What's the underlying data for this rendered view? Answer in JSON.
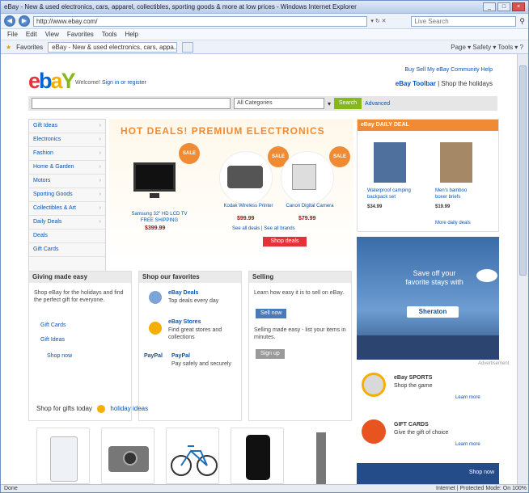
{
  "window": {
    "title": "eBay - New & used electronics, cars, apparel, collectibles, sporting goods & more at low prices - Windows Internet Explorer",
    "buttons": [
      "_",
      "□",
      "×"
    ]
  },
  "address": {
    "url": "http://www.ebay.com/",
    "search_placeholder": "Live Search"
  },
  "menu": [
    "File",
    "Edit",
    "View",
    "Favorites",
    "Tools",
    "Help"
  ],
  "favorites": {
    "label": "Favorites",
    "tab": "eBay - New & used electronics, cars, appa...",
    "right": "Page ▾  Safety ▾  Tools ▾  ?"
  },
  "ebay": {
    "logo": {
      "e": "e",
      "b": "b",
      "a": "a",
      "y": "Y"
    },
    "signin_text": "Welcome! ",
    "signin_link": "Sign in or register",
    "top_links": "Buy   Sell   My eBay   Community   Help",
    "promo_text": "eBay Toolbar",
    "promo_link": "| Shop the holidays",
    "search": {
      "category": "All Categories",
      "button": "Search",
      "advanced": "Advanced"
    },
    "categories": [
      "Gift Ideas",
      "Electronics",
      "Fashion",
      "Home & Garden",
      "Motors",
      "Sporting Goods",
      "Collectibles & Art",
      "Daily Deals",
      "Deals",
      "Gift Cards"
    ],
    "deals": {
      "title": "HOT DEALS! PREMIUM ELECTRONICS",
      "item1": "Samsung 32\" HD LCD TV\nFREE SHIPPING",
      "item1_price": "$399.99",
      "item2": "Kodak Wireless Printer",
      "item2_price": "$99.99",
      "item3": "Canon Digital Camera",
      "item3_price": "$79.99",
      "links": "See all deals  |  See all brands",
      "button": "Shop deals"
    },
    "daily_deal": {
      "head": "eBay DAILY DEAL",
      "item1": "Waterproof camping\nbackpack set",
      "item1_price": "$34.99",
      "item2": "Men's bamboo\nboxer briefs",
      "item2_price": "$19.99",
      "more": "More daily deals"
    },
    "ad": {
      "text": "Save off your favorite stays with",
      "button": "Sheraton",
      "sponsor": "Advertisement"
    },
    "col1": {
      "head": "Giving made easy",
      "text": "Shop eBay for the holidays and find the perfect gift for everyone.",
      "link1": "Gift Cards",
      "link2": "Gift Ideas",
      "link3": "Shop now"
    },
    "col2": {
      "head": "Shop our favorites",
      "item1": "eBay Deals",
      "item1_sub": "Top deals every day",
      "item2": "eBay Stores",
      "item2_sub": "Find great stores and collections",
      "item3_logo": "PayPal",
      "item3": "PayPal",
      "item3_sub": "Pay safely and securely"
    },
    "col3": {
      "head": "Selling",
      "text": "Learn how easy it is to sell on eBay.",
      "button1": "Sell now",
      "text2": "Selling made easy - list your items in minutes.",
      "button2": "Sign up"
    },
    "right1": {
      "title": "eBay SPORTS",
      "sub": "Shop the game",
      "link": "Learn more"
    },
    "right2": {
      "title": "GIFT CARDS",
      "sub": "Give the gift of choice",
      "link": "Learn more"
    },
    "cheers": "Shop for gifts today",
    "cheers_tag": "holiday ideas",
    "bottom_tile": "Shop now"
  },
  "status": {
    "left": "Done",
    "right": "Internet | Protected Mode: On   100%"
  }
}
